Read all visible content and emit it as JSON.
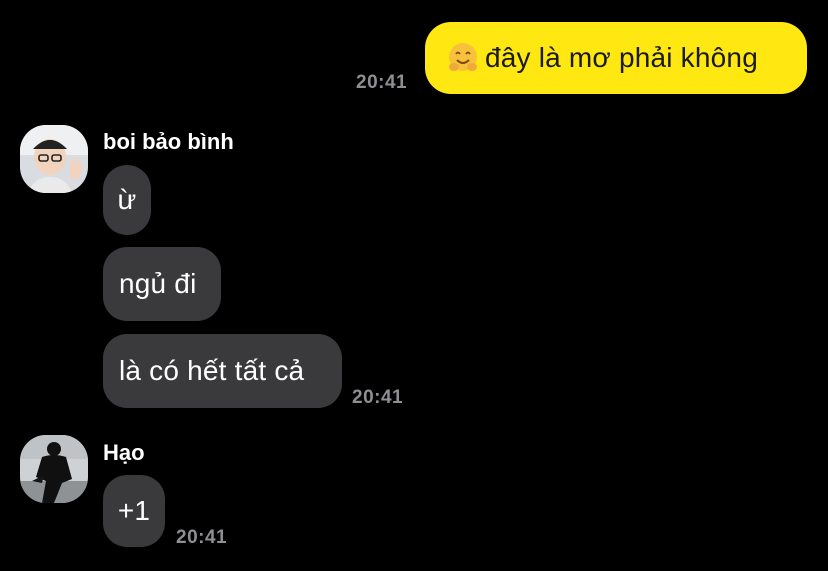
{
  "messages": {
    "outgoing": {
      "text": "đây là mơ phải không",
      "emoji": "hugging-face-emoji",
      "time": "20:41"
    },
    "group1": {
      "sender": "boi bảo bình",
      "avatar": "boy-glasses-waving-avatar",
      "bubbles": [
        "ừ",
        "ngủ đi",
        "là có hết tất cả"
      ],
      "time": "20:41"
    },
    "group2": {
      "sender": "Hạo",
      "avatar": "person-black-outfit-avatar",
      "bubbles": [
        "+1"
      ],
      "time": "20:41"
    }
  },
  "colors": {
    "background": "#000000",
    "outgoing_bubble": "#ffe812",
    "incoming_bubble": "#3a3a3c",
    "timestamp": "#8e8e93"
  }
}
